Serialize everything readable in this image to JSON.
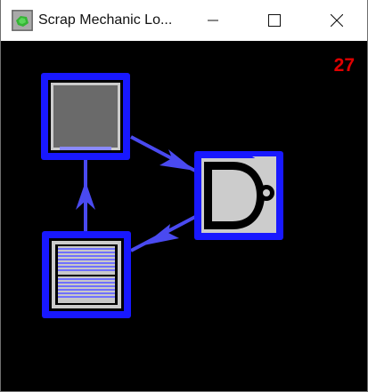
{
  "window": {
    "title": "Scrap Mechanic Lo...",
    "app_icon": "scrap-mechanic-app-icon",
    "minimize_icon": "minimize-icon",
    "maximize_icon": "maximize-icon",
    "close_icon": "close-icon"
  },
  "canvas": {
    "tick_count": "27",
    "tick_color": "#e00000",
    "background": "#000000"
  },
  "diagram": {
    "nodes": [
      {
        "id": "timer",
        "type": "timer-block",
        "icon": "timer-block-icon"
      },
      {
        "id": "logic",
        "type": "nand-logic-gate",
        "icon": "nand-gate-icon"
      },
      {
        "id": "memory",
        "type": "memory-block",
        "icon": "memory-block-icon"
      }
    ],
    "connections": [
      {
        "from": "timer",
        "to": "logic"
      },
      {
        "from": "logic",
        "to": "memory"
      },
      {
        "from": "memory",
        "to": "timer"
      }
    ],
    "selection_color": "#1818ff",
    "wire_color": "#4a4af0",
    "block_fill": "#6a6a6a",
    "gate_fill": "#cccccc"
  }
}
